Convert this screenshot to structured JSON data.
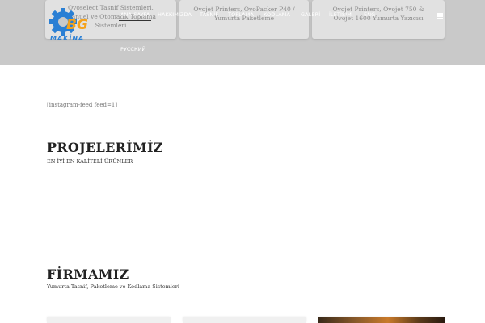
{
  "hero": {
    "cards": [
      {
        "lines": [
          "Ovoselect Tasnif Sistemleri,",
          "Manuel ve Otomatik Toplama",
          "Sistemleri"
        ]
      },
      {
        "lines": [
          "Ovojet Printers, OvoPacker P40 /",
          "Yumurta Paketleme"
        ]
      },
      {
        "lines": [
          "Ovojet Printers, Ovojet 750 &",
          "Ovojet 1600 Yumurta Yazıcısı"
        ]
      }
    ]
  },
  "logo": {
    "text": "BG",
    "subtext": "MAKİNA",
    "gear_color": "#2a7fd4",
    "text_color": "#f5a21b"
  },
  "nav": {
    "items": [
      {
        "label": "ANA SAYFA"
      },
      {
        "label": "HAKKIMIZDA"
      },
      {
        "label": "TASNİF"
      },
      {
        "label": "TOPLAMA"
      },
      {
        "label": "KODLAMA"
      },
      {
        "label": "GALERİ"
      },
      {
        "label": "İLETİŞİM"
      },
      {
        "label": "ENG"
      }
    ],
    "lang_ru": "РУССКИЙ",
    "menu_icon": "hamburger-icon"
  },
  "content": {
    "shortcode": "[instagram-feed feed=1]",
    "projects": {
      "title": "PROJELERİMİZ",
      "subtitle": "EN İYİ EN KALİTELİ ÜRÜNLER"
    },
    "company": {
      "title": "FİRMAMIZ",
      "subtitle": "Yumurta Tasnif, Paketleme ve Kodlama Sistemleri"
    }
  }
}
